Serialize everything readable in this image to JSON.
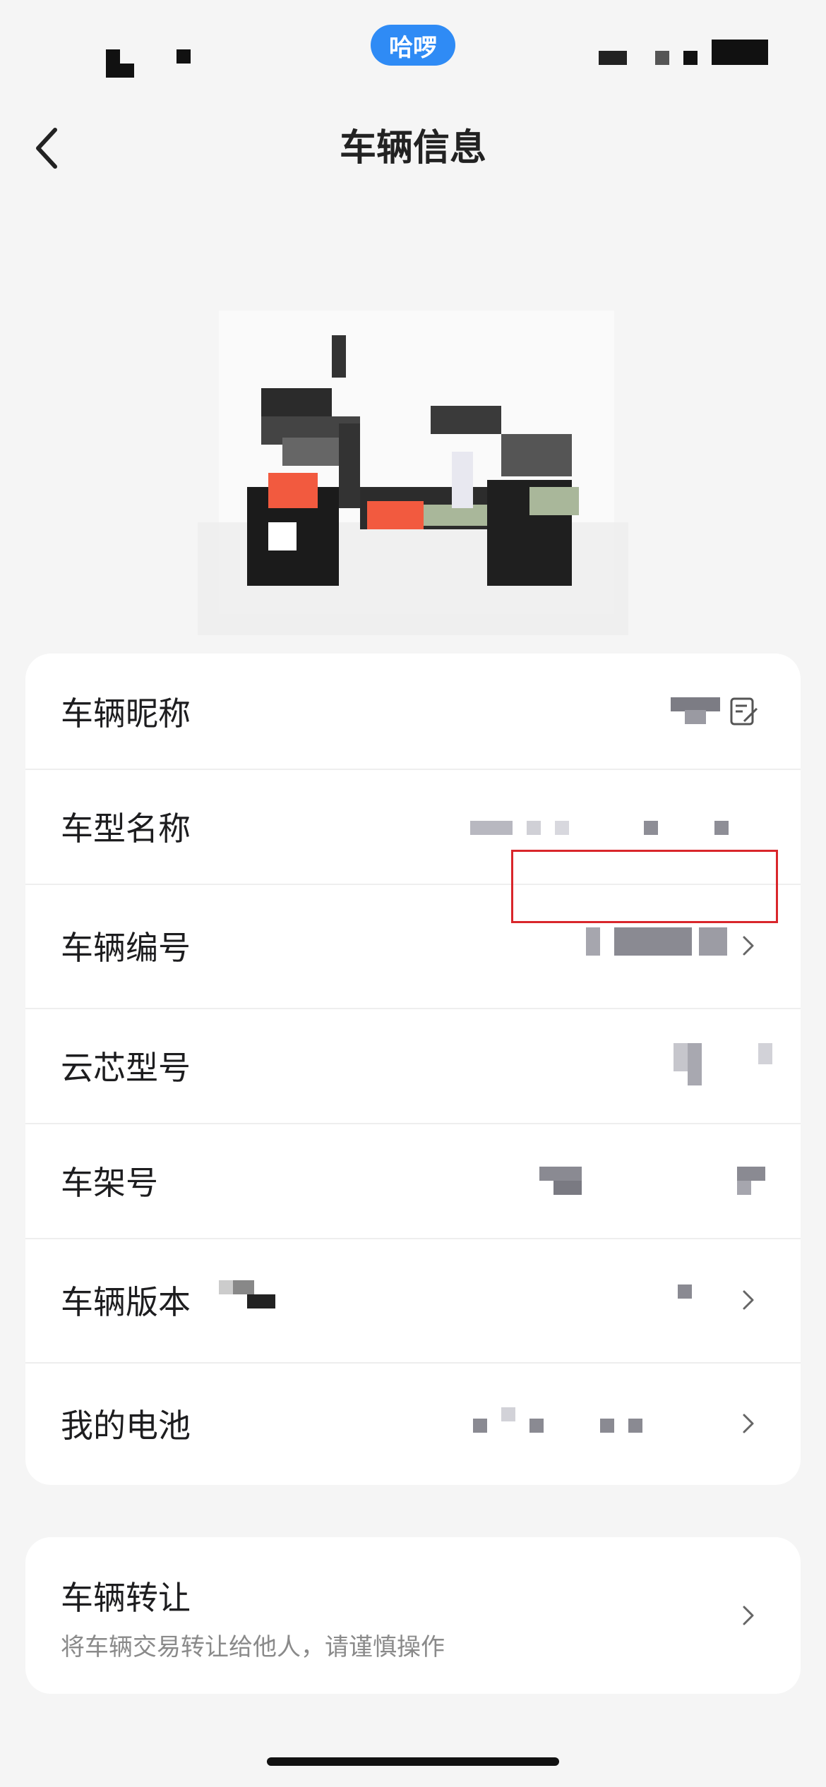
{
  "status_bar": {
    "app_badge": "哈啰"
  },
  "nav": {
    "title": "车辆信息"
  },
  "info_rows": [
    {
      "label": "车辆昵称"
    },
    {
      "label": "车型名称"
    },
    {
      "label": "车辆编号"
    },
    {
      "label": "云芯型号"
    },
    {
      "label": "车架号"
    },
    {
      "label": "车辆版本"
    },
    {
      "label": "我的电池"
    }
  ],
  "transfer": {
    "title": "车辆转让",
    "subtitle": "将车辆交易转让给他人，请谨慎操作"
  }
}
